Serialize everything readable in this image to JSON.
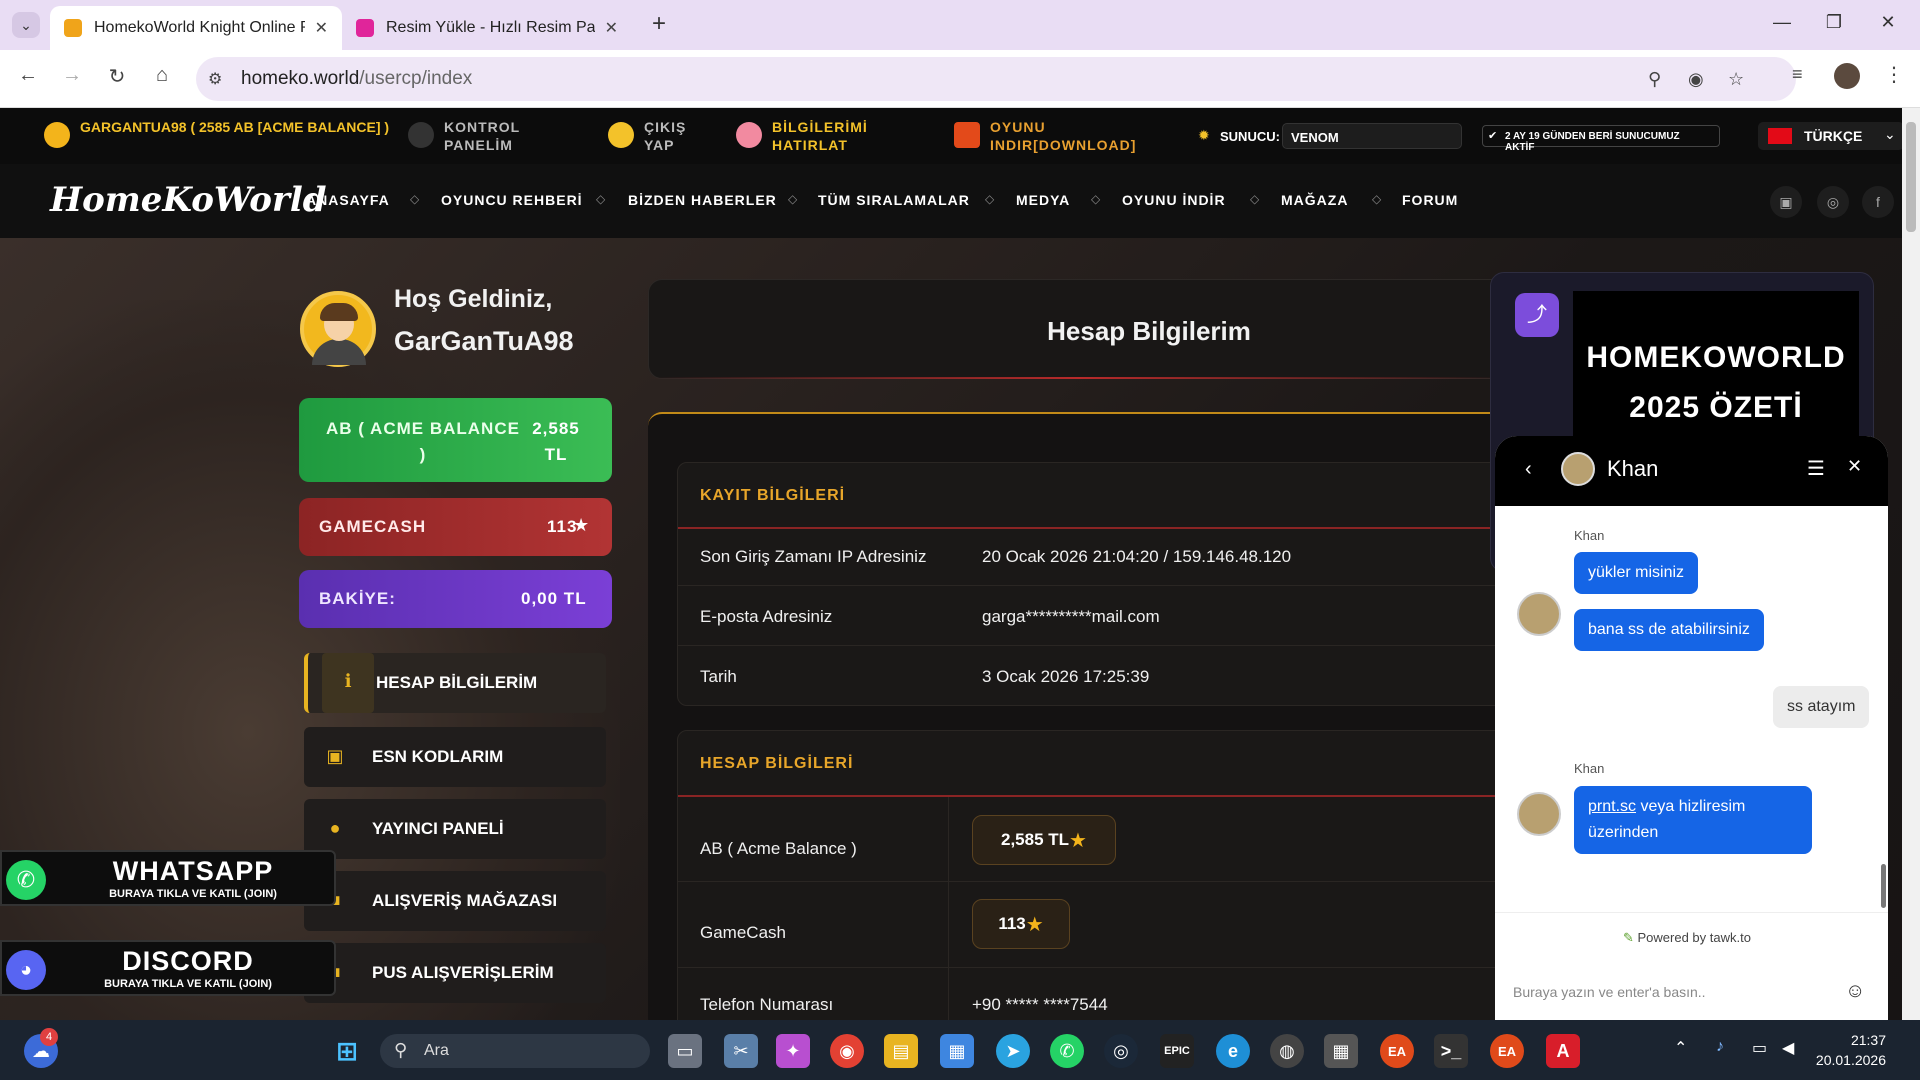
{
  "browser": {
    "tabs": [
      {
        "title": "HomekoWorld Knight Online Pvp",
        "active": true
      },
      {
        "title": "Resim Yükle - Hızlı Resim Paylaş",
        "active": false
      }
    ],
    "url_domain": "homeko.world",
    "url_path": "/usercp/index",
    "new_tab": "+",
    "close": "✕"
  },
  "topbar": {
    "user": "GARGANTUA98 ( 2585 AB [ACME BALANCE] )",
    "control_panel": [
      "KONTROL",
      "PANELİM"
    ],
    "logout": [
      "ÇIKIŞ",
      "YAP"
    ],
    "remember": [
      "BİLGİLERİMİ",
      "HATIRLAT"
    ],
    "download": [
      "OYUNU",
      "INDIR[DOWNLOAD]"
    ],
    "server_label": "SUNUCU:",
    "server_value": "VENOM",
    "active_notice": "2 AY 19 GÜNDEN BERİ SUNUCUMUZ AKTİF",
    "language": "TÜRKÇE"
  },
  "nav": {
    "logo": "HomeKoWorld",
    "items": [
      "ANASAYFA",
      "OYUNCU REHBERİ",
      "BİZDEN HABERLER",
      "TÜM SIRALAMALAR",
      "MEDYA",
      "OYUNU İNDİR",
      "MAĞAZA",
      "FORUM"
    ]
  },
  "profile": {
    "greeting": "Hoş Geldiniz,",
    "username": "GarGanTuA98",
    "ab_label": "AB ( ACME BALANCE )",
    "ab_value": "2,585 TL",
    "gamecash_label": "GAMECASH",
    "gamecash_value": "113",
    "balance_label": "BAKİYE:",
    "balance_value": "0,00 TL",
    "menu": [
      "HESAP BİLGİLERİM",
      "ESN KODLARIM",
      "YAYINCI PANELİ",
      "ALIŞVERİŞ MAĞAZASI",
      "PUS ALIŞVERİŞLERİM"
    ]
  },
  "account": {
    "title": "Hesap Bilgilerim",
    "reg_title": "KAYIT BİLGİLERİ",
    "reg_rows": [
      {
        "label": "Son Giriş Zamanı IP Adresiniz",
        "value": "20 Ocak 2026 21:04:20 / 159.146.48.120"
      },
      {
        "label": "E-posta Adresiniz",
        "value": "garga**********mail.com"
      },
      {
        "label": "Tarih",
        "value": "3 Ocak 2026 17:25:39"
      }
    ],
    "acc_title": "HESAP BİLGİLERİ",
    "acc_rows": [
      {
        "label": "AB ( Acme Balance )",
        "value": "2,585 TL"
      },
      {
        "label": "GameCash",
        "value": "113"
      },
      {
        "label": "Telefon Numarası",
        "value": "+90 ***** ****7544"
      }
    ]
  },
  "promo": {
    "line1": "HOMEKOWORLD",
    "line2": "2025 ÖZETİ"
  },
  "floating": {
    "whatsapp": "WHATSAPP",
    "whatsapp_sub": "BURAYA TIKLA VE KATIL (JOIN)",
    "discord": "DISCORD",
    "discord_sub": "BURAYA TIKLA VE KATIL (JOIN)"
  },
  "chat": {
    "agent": "Khan",
    "messages": [
      {
        "sender": "Khan",
        "texts": [
          "yükler misiniz",
          "bana ss de atabilirsiniz"
        ]
      },
      {
        "sender": "me",
        "texts": [
          "ss atayım"
        ]
      },
      {
        "sender": "Khan",
        "link": "prnt.sc",
        "text": " veya hizliresim üzerinden"
      }
    ],
    "powered": "Powered by tawk.to",
    "placeholder": "Buraya yazın ve enter'a basın.."
  },
  "taskbar": {
    "search": "Ara",
    "time": "21:37",
    "date": "20.01.2026",
    "weather_badge": "4"
  }
}
